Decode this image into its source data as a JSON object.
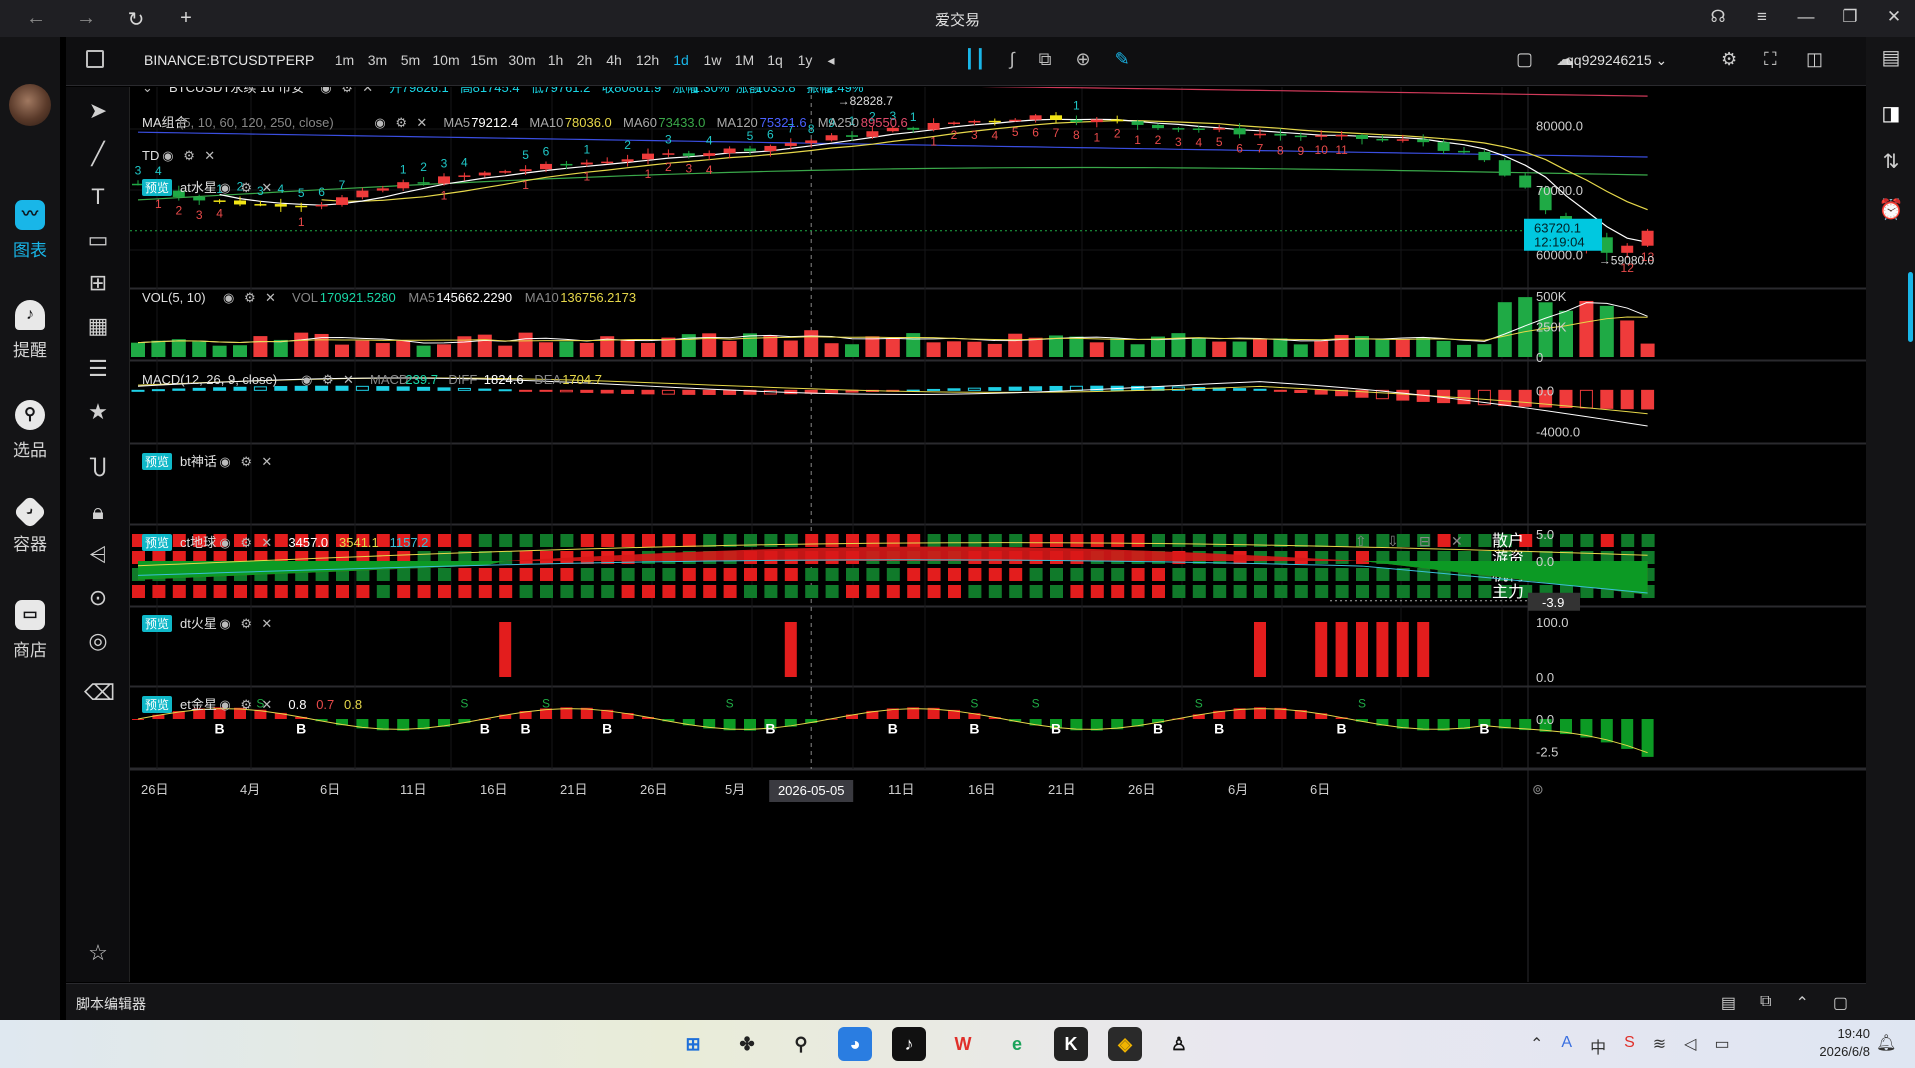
{
  "window": {
    "title": "爱交易",
    "nav_icons": [
      "back-arrow-icon",
      "forward-arrow-icon",
      "reload-icon",
      "plus-icon"
    ],
    "controls": [
      "headset-icon",
      "hamburger-menu-icon",
      "minimize-icon",
      "restore-icon",
      "close-icon"
    ]
  },
  "left_nav": {
    "items": [
      {
        "label": "图表",
        "icon": "chart-icon",
        "active": true
      },
      {
        "label": "提醒",
        "icon": "bell-icon",
        "active": false
      },
      {
        "label": "选品",
        "icon": "search-icon",
        "active": false
      },
      {
        "label": "容器",
        "icon": "container-icon",
        "active": false
      },
      {
        "label": "商店",
        "icon": "store-icon",
        "active": false
      }
    ]
  },
  "toolbar": {
    "symbol": "BINANCE:BTCUSDTPERP",
    "intervals": [
      "1m",
      "3m",
      "5m",
      "10m",
      "15m",
      "30m",
      "1h",
      "2h",
      "4h",
      "12h",
      "1d",
      "1w",
      "1M",
      "1q",
      "1y"
    ],
    "selected_interval": "1d",
    "account": "qq929246215"
  },
  "main_pane": {
    "symbol_line": "BTCUSDT永续  1d  币安",
    "open_label": "开",
    "open": "79826.1",
    "high_label": "高",
    "high": "81745.4",
    "low_label": "低",
    "low": "79761.2",
    "close_label": "收",
    "close": "80861.9",
    "change_label": "涨幅",
    "change": "1.30%",
    "amount_label": "涨额",
    "amount": "1035.8",
    "amplitude_label": "振幅",
    "amplitude": "2.49%",
    "ma_title": "MA组合",
    "ma_params": "(5, 10, 60, 120, 250, close)",
    "ma5_label": "MA5",
    "ma5": "79212.4",
    "ma10_label": "MA10",
    "ma10": "78036.0",
    "ma60_label": "MA60",
    "ma60": "73433.0",
    "ma120_label": "MA120",
    "ma120": "75321.6",
    "ma250_label": "MA250",
    "ma250": "89550.6",
    "td_title": "TD",
    "at_badge": "预览",
    "at_title": "at水星",
    "high_marker": "82828.7",
    "low_marker": "59080.0",
    "price_ticks": [
      "80000.0",
      "70000.0",
      "60000.0"
    ],
    "last_price": "63720.1",
    "countdown": "12:19:04",
    "td_up_counts": [
      "3",
      "4",
      "1",
      "2",
      "3",
      "4",
      "5",
      "6",
      "7",
      "1",
      "2",
      "3",
      "4",
      "5",
      "6",
      "1",
      "2",
      "3",
      "4",
      "5",
      "6",
      "7",
      "8",
      "9",
      "1",
      "2",
      "3",
      "1",
      "1"
    ],
    "td_down_counts": [
      "1",
      "2",
      "3",
      "4",
      "1",
      "1",
      "1",
      "1",
      "1",
      "2",
      "3",
      "4",
      "1",
      "2",
      "3",
      "4",
      "5",
      "6",
      "7",
      "8",
      "1",
      "2",
      "1",
      "2",
      "3",
      "4",
      "5",
      "6",
      "7",
      "8",
      "9",
      "10",
      "11",
      "12",
      "13"
    ]
  },
  "vol_pane": {
    "title": "VOL(5, 10)",
    "vol_label": "VOL",
    "vol": "170921.5280",
    "ma5_label": "MA5",
    "ma5": "145662.2290",
    "ma10_label": "MA10",
    "ma10": "136756.2173",
    "ticks": [
      "500K",
      "250K",
      "0"
    ]
  },
  "macd_pane": {
    "title": "MACD(12, 26, 9, close)",
    "macd_label": "MACD",
    "macd": "239.7",
    "diff_label": "DIFF",
    "diff": "1824.6",
    "dea_label": "DEA",
    "dea": "1704.7",
    "ticks": [
      "0.0",
      "-4000.0"
    ]
  },
  "bt_pane": {
    "badge": "预览",
    "title": "bt神话",
    "row_labels": [
      "散户",
      "游资",
      "机构",
      "主力"
    ],
    "ticks": [
      "5.0",
      "0.0"
    ],
    "current": "-3.9"
  },
  "ct_pane": {
    "badge": "预览",
    "title": "ct地球",
    "v1": "3457.0",
    "v2": "3541.1",
    "v3": "1157.2",
    "ticks": [
      "0.0"
    ]
  },
  "dt_pane": {
    "badge": "预览",
    "title": "dt火星",
    "ticks": [
      "100.0",
      "0.0"
    ]
  },
  "et_pane": {
    "badge": "预览",
    "title": "et金星",
    "v1": "0.8",
    "v2": "0.7",
    "v3": "0.8",
    "buy_marker": "B",
    "sell_marker": "S",
    "ticks": [
      "0.0",
      "-2.5"
    ]
  },
  "time_axis": {
    "labels": [
      "26日",
      "4月",
      "6日",
      "11日",
      "16日",
      "21日",
      "26日",
      "5月",
      "11日",
      "16日",
      "21日",
      "26日",
      "6月",
      "6日"
    ],
    "crosshair_date": "2026-05-05"
  },
  "bottom_panel": {
    "label": "脚本编辑器"
  },
  "taskbar": {
    "time": "19:40",
    "date": "2026/6/8",
    "apps": [
      "start-windows-icon",
      "pinwheel-icon",
      "taskbar-search-icon",
      "bird-app-icon",
      "tiktok-icon",
      "wps-icon",
      "edge-browser-icon",
      "kwai-icon",
      "trading-app-icon",
      "qq-penguin-icon"
    ]
  },
  "colors": {
    "up": "#ef3b3b",
    "down": "#1faa45",
    "accent": "#19b6e8",
    "ma5": "#ffffff",
    "ma10": "#e6d84a",
    "ma60": "#3aa84a",
    "ma120": "#3a4ee0",
    "ma250": "#d03a5a"
  }
}
